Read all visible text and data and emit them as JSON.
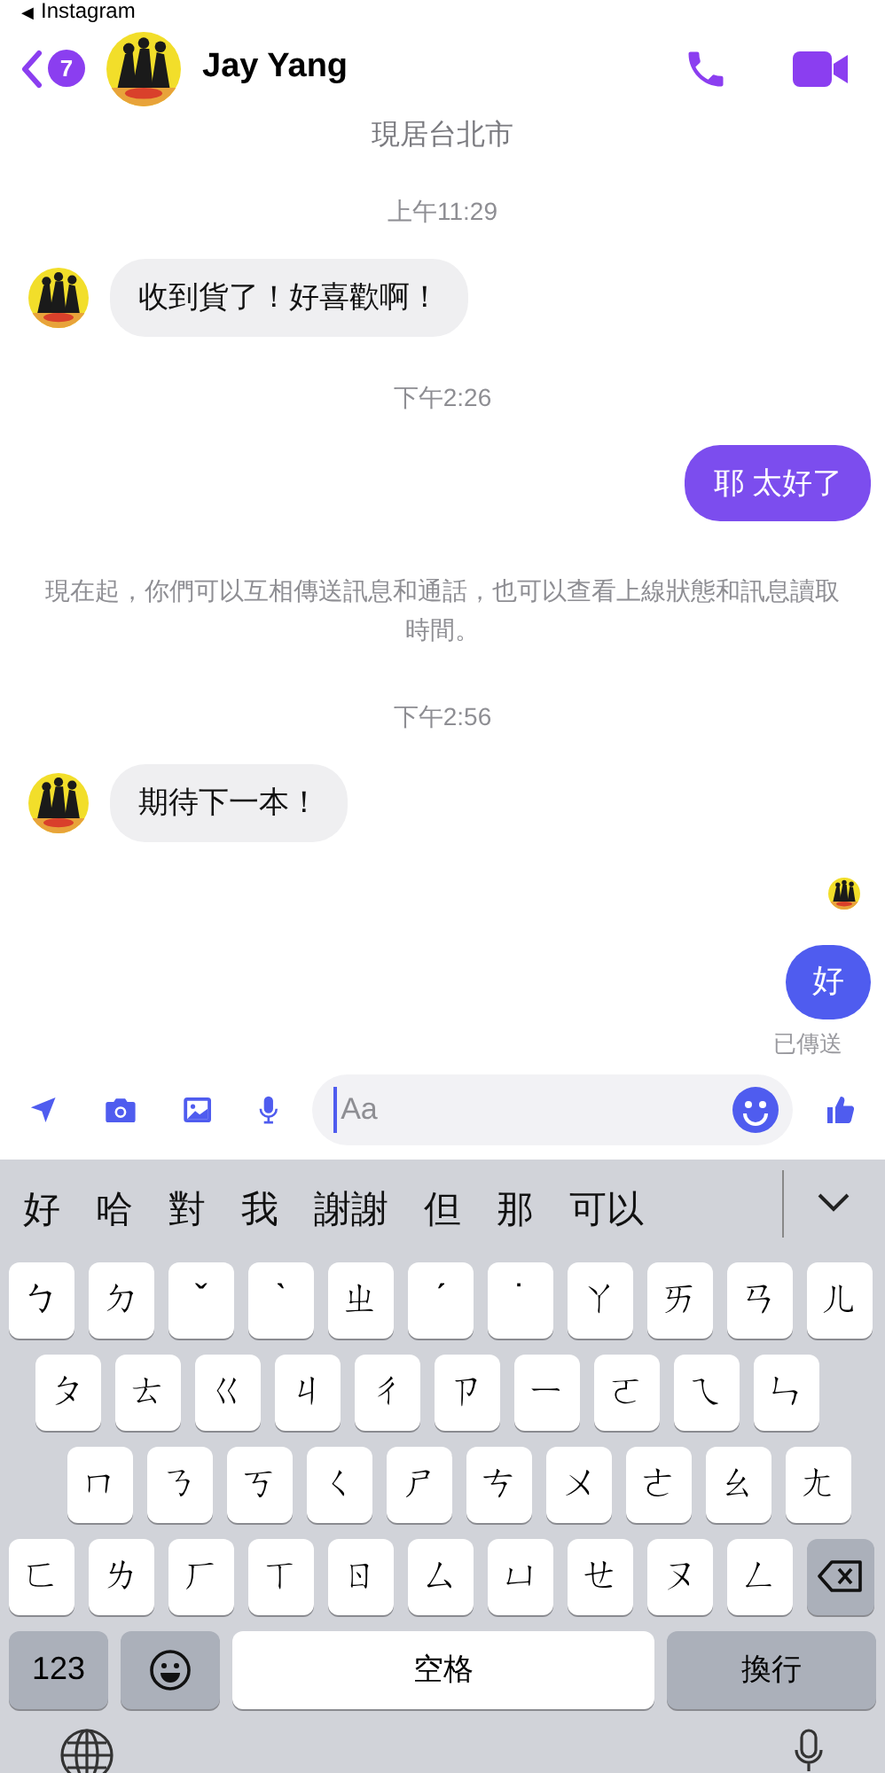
{
  "status_bar": {
    "back_arrow": "◀",
    "app": "Instagram"
  },
  "header": {
    "unread_count": "7",
    "name": "Jay Yang"
  },
  "subtitle": "現居台北市",
  "messages": [
    {
      "kind": "time",
      "text": "上午11:29"
    },
    {
      "kind": "incoming",
      "text": "收到貨了！好喜歡啊！"
    },
    {
      "kind": "time",
      "text": "下午2:26"
    },
    {
      "kind": "outgoing",
      "text": "耶 太好了"
    },
    {
      "kind": "notice",
      "text": "現在起，你們可以互相傳送訊息和通話，也可以查看上線狀態和訊息讀取時間。"
    },
    {
      "kind": "time",
      "text": "下午2:56"
    },
    {
      "kind": "incoming",
      "text": "期待下一本！"
    },
    {
      "kind": "seen"
    },
    {
      "kind": "outgoing_round",
      "text": "好"
    },
    {
      "kind": "status",
      "text": "已傳送"
    }
  ],
  "composer": {
    "placeholder": "Aa"
  },
  "keyboard": {
    "candidates": [
      "好",
      "哈",
      "對",
      "我",
      "謝謝",
      "但",
      "那",
      "可以"
    ],
    "rows": [
      [
        "ㄅ",
        "ㄉ",
        "ˇ",
        "ˋ",
        "ㄓ",
        "ˊ",
        "˙",
        "ㄚ",
        "ㄞ",
        "ㄢ",
        "ㄦ"
      ],
      [
        "ㄆ",
        "ㄊ",
        "ㄍ",
        "ㄐ",
        "ㄔ",
        "ㄗ",
        "ㄧ",
        "ㄛ",
        "ㄟ",
        "ㄣ"
      ],
      [
        "ㄇ",
        "ㄋ",
        "ㄎ",
        "ㄑ",
        "ㄕ",
        "ㄘ",
        "ㄨ",
        "ㄜ",
        "ㄠ",
        "ㄤ"
      ],
      [
        "ㄈ",
        "ㄌ",
        "ㄏ",
        "ㄒ",
        "ㄖ",
        "ㄙ",
        "ㄩ",
        "ㄝ",
        "ㄡ",
        "ㄥ"
      ]
    ],
    "numbers_key": "123",
    "space_key": "空格",
    "return_key": "換行"
  }
}
